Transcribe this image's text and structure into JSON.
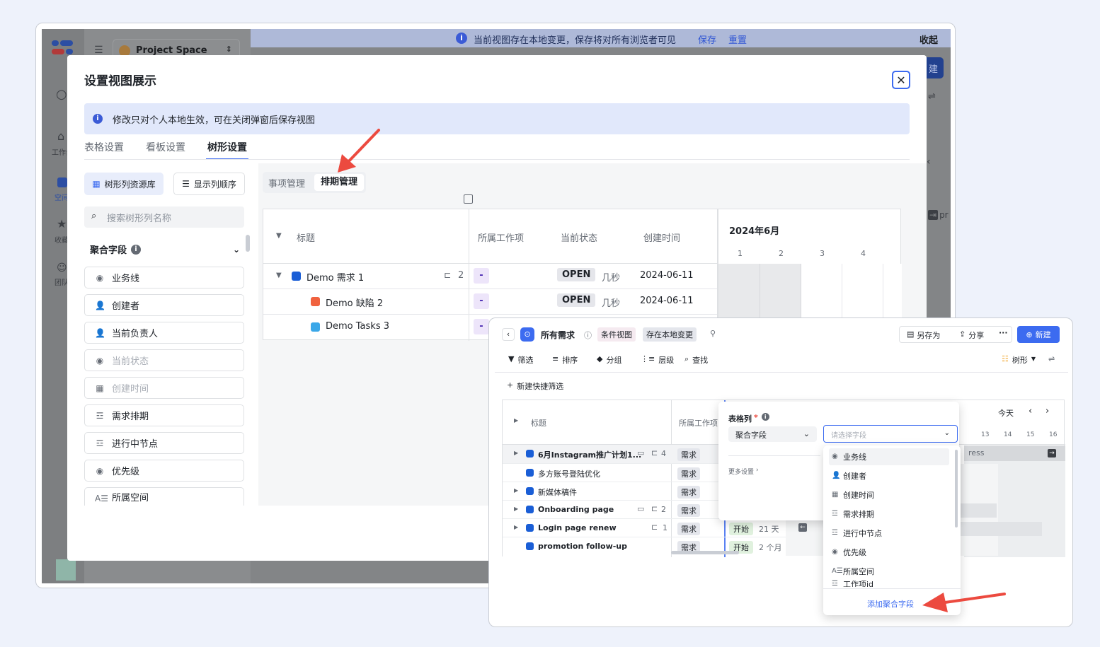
{
  "background_app": {
    "workspace_name": "Project Space",
    "banner_text": "当前视图存在本地变更，保存将对所有浏览者可见",
    "banner_save": "保存",
    "banner_reset": "重置",
    "banner_collapse": "收起",
    "nav_labels": [
      "工作台",
      "空间",
      "收藏",
      "团队"
    ],
    "new_button_fragment": "建",
    "pr_fragment": "pr"
  },
  "modal": {
    "title": "设置视图展示",
    "notice": "修改只对个人本地生效，可在关闭弹窗后保存视图",
    "tabs": [
      "表格设置",
      "看板设置",
      "树形设置"
    ],
    "active_tab": 2,
    "library_button": "树形列资源库",
    "order_button": "显示列顺序",
    "search_placeholder": "搜索树形列名称",
    "group_title": "聚合字段",
    "fields": [
      {
        "label": "业务线",
        "icon": "dropdown-icon",
        "dim": false
      },
      {
        "label": "创建者",
        "icon": "user-icon",
        "dim": false
      },
      {
        "label": "当前负责人",
        "icon": "user-icon",
        "dim": false
      },
      {
        "label": "当前状态",
        "icon": "dropdown-icon",
        "dim": true
      },
      {
        "label": "创建时间",
        "icon": "calendar-icon",
        "dim": true
      },
      {
        "label": "需求排期",
        "icon": "schedule-icon",
        "dim": false
      },
      {
        "label": "进行中节点",
        "icon": "schedule-icon",
        "dim": false
      },
      {
        "label": "优先级",
        "icon": "dropdown-icon",
        "dim": false
      },
      {
        "label": "所属空间",
        "icon": "space-icon",
        "dim": false
      }
    ],
    "segment": [
      "事项管理",
      "排期管理"
    ],
    "segment_active": 1,
    "preview": {
      "headers": [
        "标题",
        "所属工作项",
        "当前状态",
        "创建时间"
      ],
      "month": "2024年6月",
      "days": [
        "1",
        "2",
        "3",
        "4"
      ],
      "rows": [
        {
          "title": "Demo 需求 1",
          "color": "#1a5ed6",
          "sub": "2",
          "workitem": "-",
          "status": "OPEN",
          "ago": "几秒",
          "date": "2024-06-11"
        },
        {
          "title": "Demo 缺陷 2",
          "color": "#f0623f",
          "sub": "",
          "workitem": "-",
          "status": "OPEN",
          "ago": "几秒",
          "date": "2024-06-11"
        },
        {
          "title": "Demo Tasks 3",
          "color": "#3aa7e8",
          "sub": "",
          "workitem": "-",
          "status": "",
          "ago": "",
          "date": ""
        }
      ]
    }
  },
  "window2": {
    "title": "所有需求",
    "chip_condition": "条件视图",
    "chip_local": "存在本地变更",
    "save_as": "另存为",
    "share": "分享",
    "new": "新建",
    "toolbar": [
      "筛选",
      "排序",
      "分组",
      "层级",
      "查找"
    ],
    "view_type": "树形",
    "quick_filter": "新建快捷筛选",
    "grid_headers": [
      "标题",
      "所属工作项"
    ],
    "today": "今天",
    "days": [
      "13",
      "14",
      "15",
      "16"
    ],
    "press_fragment": "ress",
    "rows": [
      {
        "title": "6月Instagram推广计划1...",
        "count": "4",
        "tag": "需求",
        "start": "",
        "dur": ""
      },
      {
        "title": "多方账号登陆优化",
        "count": "",
        "tag": "需求",
        "start": "",
        "dur": ""
      },
      {
        "title": "新媒体稿件",
        "count": "",
        "tag": "需求",
        "start": "",
        "dur": ""
      },
      {
        "title": "Onboarding page",
        "count": "2",
        "tag": "需求",
        "start": "",
        "dur": ""
      },
      {
        "title": "Login page renew",
        "count": "1",
        "tag": "需求",
        "start": "开始",
        "dur": "21 天"
      },
      {
        "title": "promotion follow-up",
        "count": "",
        "tag": "需求",
        "start": "开始",
        "dur": "2 个月"
      }
    ],
    "popover": {
      "label": "表格列",
      "required": "*",
      "group_select": "聚合字段",
      "field_placeholder": "请选择字段",
      "more": "更多设置"
    },
    "options": [
      "业务线",
      "创建者",
      "创建时间",
      "需求排期",
      "进行中节点",
      "优先级",
      "所属空间",
      "工作项id"
    ],
    "add_group_field": "添加聚合字段"
  },
  "colors": {
    "accent": "#3c6bf0",
    "arrow": "#ec4a3f"
  }
}
